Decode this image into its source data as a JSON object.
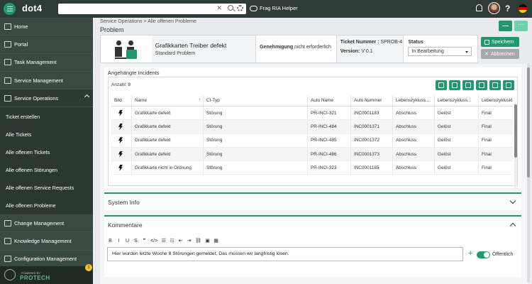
{
  "app": {
    "name": "dot4",
    "ria_label": "Frag RIA Helper"
  },
  "search": {
    "value": "",
    "placeholder": ""
  },
  "sidebar": {
    "items": [
      {
        "label": "Home"
      },
      {
        "label": "Portal"
      },
      {
        "label": "Task Management"
      },
      {
        "label": "Service Management"
      },
      {
        "label": "Service Operations"
      }
    ],
    "subitems": [
      {
        "label": "Ticket erstellen"
      },
      {
        "label": "Alle Tickets"
      },
      {
        "label": "Alle offenen Tickets"
      },
      {
        "label": "Alle offenen Störungen"
      },
      {
        "label": "Alle offenen Service Requests"
      },
      {
        "label": "Alle offenen Probleme"
      }
    ],
    "bottom_items": [
      {
        "label": "Change Management"
      },
      {
        "label": "Knowledge Management"
      },
      {
        "label": "Configuration Management"
      }
    ],
    "powered_by": "POWERED BY",
    "powered_brand": "PROTECH",
    "badge": "1"
  },
  "breadcrumb": "Service Operations > Alle offenen Probleme",
  "page_title": "Problem",
  "header": {
    "name": "Grafikkarten Treiber defekt",
    "type": "Standard Problem",
    "approval_bold": "Genehmigung",
    "approval_text": "nicht erforderlich",
    "ticket_label": "Ticket Nummer :",
    "ticket_number": "SPROB-4",
    "version_label": "Version:",
    "version": "V 0.1",
    "status_label": "Status",
    "status_value": "In Bearbeitung",
    "save_label": "Speichern",
    "cancel_label": "Abbrechen"
  },
  "incidents": {
    "title": "Angehängte Incidents",
    "count": "Anzahl: 8",
    "columns": [
      "Bild",
      "Name",
      "CI-Typ",
      "Auto Name",
      "Auto Nummer",
      "Lebenszykluss...",
      "Lebenszykluss...",
      "Lebenszyklusklas..."
    ],
    "rows": [
      [
        "Grafikkarte defekt",
        "Störung",
        "PR-INCI-321",
        "INC0001183",
        "Abschluss",
        "Gelöst",
        "Final"
      ],
      [
        "Grafikkarte defekt",
        "Störung",
        "PR-INCI-484",
        "INC0001371",
        "Abschluss",
        "Gelöst",
        "Final"
      ],
      [
        "Grafikkarte defekt",
        "Störung",
        "PR-INCI-485",
        "INC0001372",
        "Abschluss",
        "Gelöst",
        "Final"
      ],
      [
        "Grafikkarte defekt",
        "Störung",
        "PR-INCI-486",
        "INC0001373",
        "Abschluss",
        "Gelöst",
        "Final"
      ],
      [
        "Grafikkarte nicht in Ordnung",
        "Störung",
        "PR-INCI-323",
        "INC0001185",
        "Abschluss",
        "Gelöst",
        "Final"
      ]
    ]
  },
  "system_info": {
    "title": "System Info"
  },
  "comments": {
    "title": "Kommentare",
    "toolbar": [
      "B",
      "I",
      "U",
      "S",
      "❞",
      "</>",
      "☰",
      "☷",
      "⇤",
      "⇥",
      "⛓",
      "▣",
      "▦"
    ],
    "value": "Hier wurden letzte Woche 8 Störungen gemeldet. Das müssen wir langfristig lösen.",
    "public_label": "Öffentlich"
  },
  "colors": {
    "accent": "#1f9a6e",
    "sidebar": "#3a4a43",
    "topbar": "#2f3b36"
  }
}
